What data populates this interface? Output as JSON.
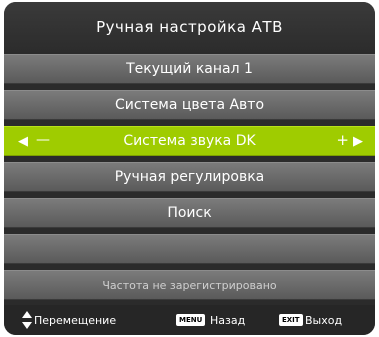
{
  "title": "Ручная настройка АТВ",
  "menu": {
    "items": [
      {
        "label": "Текущий канал 1"
      },
      {
        "label": "Система цвета Авто"
      },
      {
        "label": "Система звука DK"
      },
      {
        "label": "Ручная регулировка"
      },
      {
        "label": "Поиск"
      }
    ],
    "selected_index": 2,
    "info_text": "Частота не зарегистрировано"
  },
  "footer": {
    "move_label": "Перемещение",
    "menu_key": "MENU",
    "back_label": "Назад",
    "exit_key": "EXIT",
    "exit_label": "Выход"
  },
  "colors": {
    "background": "#2b2b2b",
    "row": "#6a6a6a",
    "selected_row": "#9fcc00",
    "text": "#ffffff"
  },
  "icons": [
    "left-arrow-icon",
    "minus-icon",
    "plus-icon",
    "right-arrow-icon",
    "up-down-arrow-icon"
  ]
}
